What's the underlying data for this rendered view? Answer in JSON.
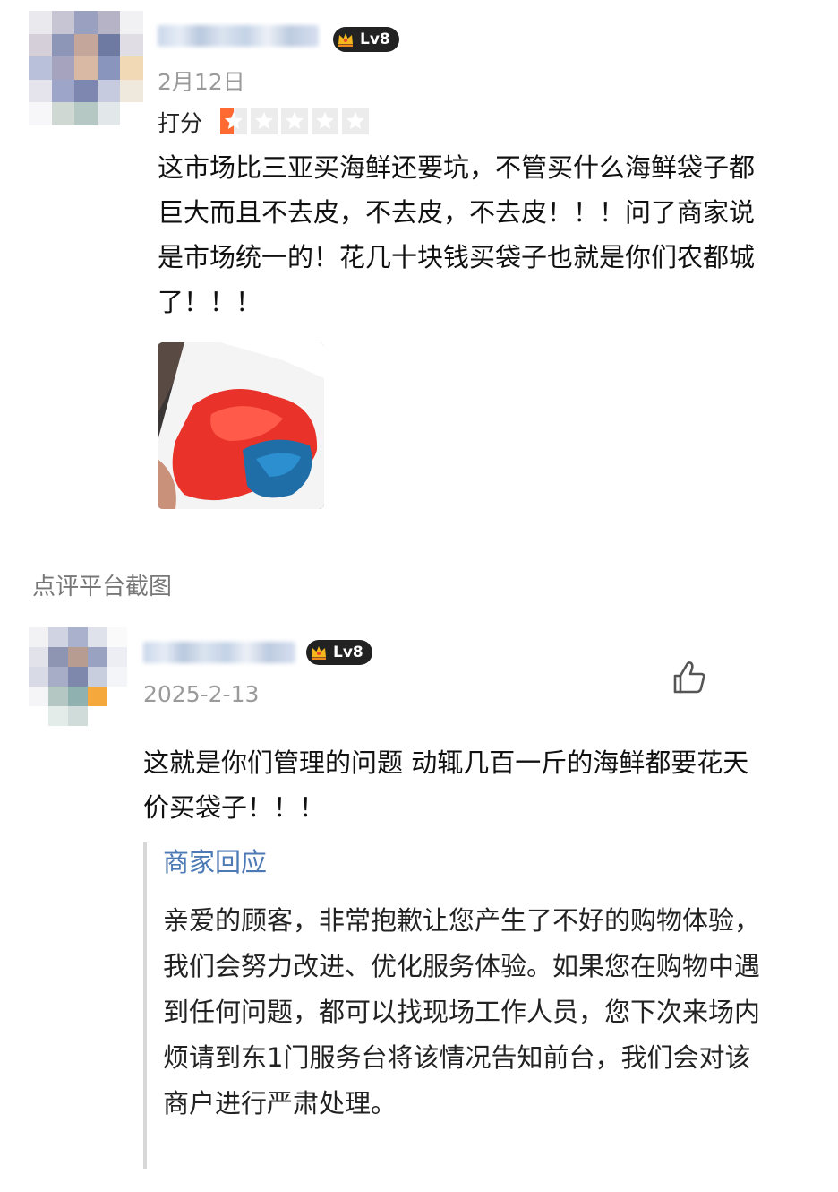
{
  "review": {
    "date": "2月12日",
    "level": "Lv8",
    "score_label": "打分",
    "rating": 0.5,
    "rating_max": 5,
    "text": "这市场比三亚买海鲜还要坑，不管买什么海鲜袋子都巨大而且不去皮，不去皮，不去皮！！！问了商家说是市场统一的！花几十块钱买袋子也就是你们农都城了！！！"
  },
  "caption": "点评平台截图",
  "comment": {
    "date": "2025-2-13",
    "level": "Lv8",
    "text": "这就是你们管理的问题 动辄几百一斤的海鲜都要花天价买袋子！！！",
    "reply": {
      "title": "商家回应",
      "text": "亲爱的顾客，非常抱歉让您产生了不好的购物体验，我们会努力改进、优化服务体验。如果您在购物中遇到任何问题，都可以找现场工作人员，您下次来场内烦请到东1门服务台将该情况告知前台，我们会对该商户进行严肃处理。"
    }
  },
  "colors": {
    "star_active": "#ff6a33",
    "star_inactive": "#ececec",
    "reply_title": "#4d7ab4",
    "level_badge": "#222222"
  }
}
